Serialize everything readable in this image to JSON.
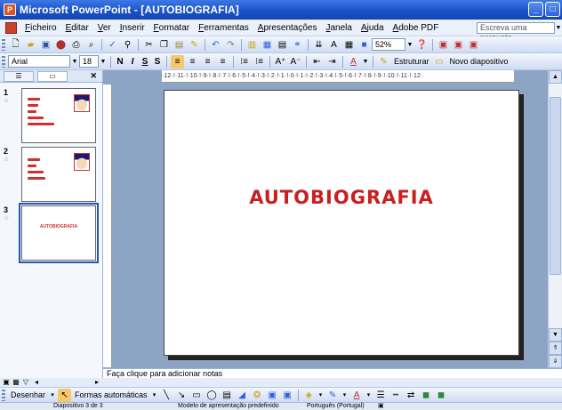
{
  "window": {
    "title": "Microsoft PowerPoint - [AUTOBIOGRAFIA]",
    "controls": [
      "_",
      "□",
      "×"
    ]
  },
  "menu": {
    "items": [
      "Ficheiro",
      "Editar",
      "Ver",
      "Inserir",
      "Formatar",
      "Ferramentas",
      "Apresentações",
      "Janela",
      "Ajuda",
      "Adobe PDF"
    ],
    "help_placeholder": "Escreva uma pergunta"
  },
  "toolbar_standard": {
    "zoom": "52%"
  },
  "toolbar_format": {
    "font": "Arial",
    "size": "18",
    "bold": "N",
    "italic": "I",
    "underline": "S",
    "shadow": "S",
    "structure_label": "Estruturar",
    "new_slide_label": "Novo diapositivo"
  },
  "slides_pane": {
    "slides": [
      {
        "number": "1",
        "title": ""
      },
      {
        "number": "2",
        "title": ""
      },
      {
        "number": "3",
        "title": "AUTOBIOGRAFIA"
      }
    ]
  },
  "ruler": {
    "horizontal": "·12·!·11·!·10·!·9·!·8·!·7·!·6·!·5·!·4·!·3·!·2·!·1·!·0·!·1·!·2·!·3·!·4·!·5·!·6·!·7·!·8·!·9·!·10·!·11·!·12·"
  },
  "slide": {
    "title": "AUTOBIOGRAFIA"
  },
  "notes": {
    "placeholder": "Faça clique para adicionar notas"
  },
  "drawing_toolbar": {
    "draw_label": "Desenhar",
    "autoshapes_label": "Formas automáticas"
  },
  "status": {
    "slide_info": "Diapositivo 3 de 3",
    "design": "Modelo de apresentação predefinido",
    "language": "Português (Portugal)"
  },
  "colors": {
    "title_red": "#c82020",
    "workspace": "#8da4c4",
    "titlebar": "#1a53c8"
  }
}
